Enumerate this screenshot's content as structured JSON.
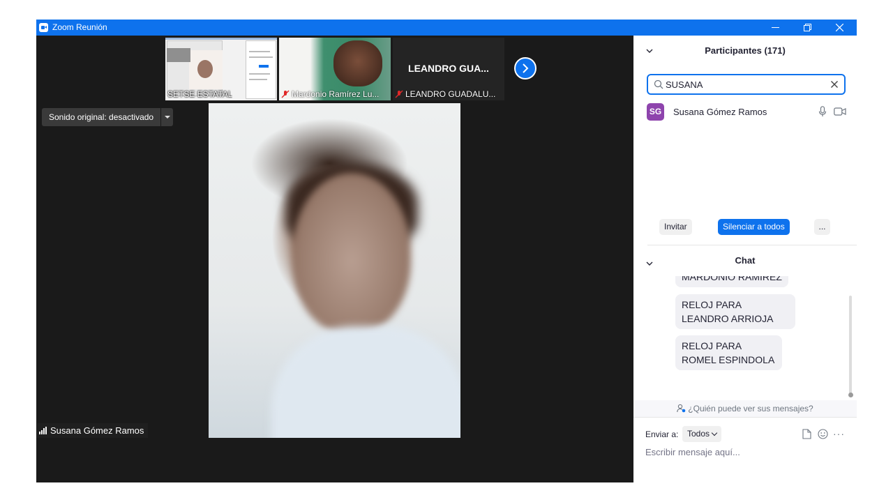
{
  "window": {
    "title": "Zoom Reunión",
    "accent_color": "#0e72ed"
  },
  "thumbnails": [
    {
      "label": "SETSE ESTATAL",
      "muted": false
    },
    {
      "label": "Mardonio Ramírez Lu...",
      "muted": true
    },
    {
      "label": "LEANDRO GUADALU...",
      "muted": true,
      "center_name": "LEANDRO GUA..."
    }
  ],
  "sound": {
    "label": "Sonido original: desactivado"
  },
  "active_speaker": {
    "name": "Susana Gómez Ramos"
  },
  "participants": {
    "title": "Participantes (171)",
    "search_value": "SUSANA",
    "list": [
      {
        "initials": "SG",
        "name": "Susana Gómez Ramos",
        "avatar_color": "#8e44ad"
      }
    ],
    "invite_label": "Invitar",
    "mute_all_label": "Silenciar a todos",
    "more_label": "..."
  },
  "chat": {
    "title": "Chat",
    "messages": [
      {
        "text": "MARDONIO RAMIREZ"
      },
      {
        "text": "RELOJ PARA LEANDRO ARRIOJA"
      },
      {
        "text": "RELOJ PARA ROMEL ESPINDOLA"
      }
    ],
    "who_sees": "¿Quién puede ver sus mensajes?",
    "send_to_label": "Enviar a:",
    "recipient": "Todos",
    "input_placeholder": "Escribir mensaje aquí..."
  },
  "icons": {
    "app": "zoom-camera-icon",
    "search": "search-icon",
    "clear": "close-icon",
    "mic": "microphone-icon",
    "camera": "video-camera-icon",
    "file": "file-icon",
    "emoji": "emoji-icon",
    "next": "chevron-right-icon"
  }
}
